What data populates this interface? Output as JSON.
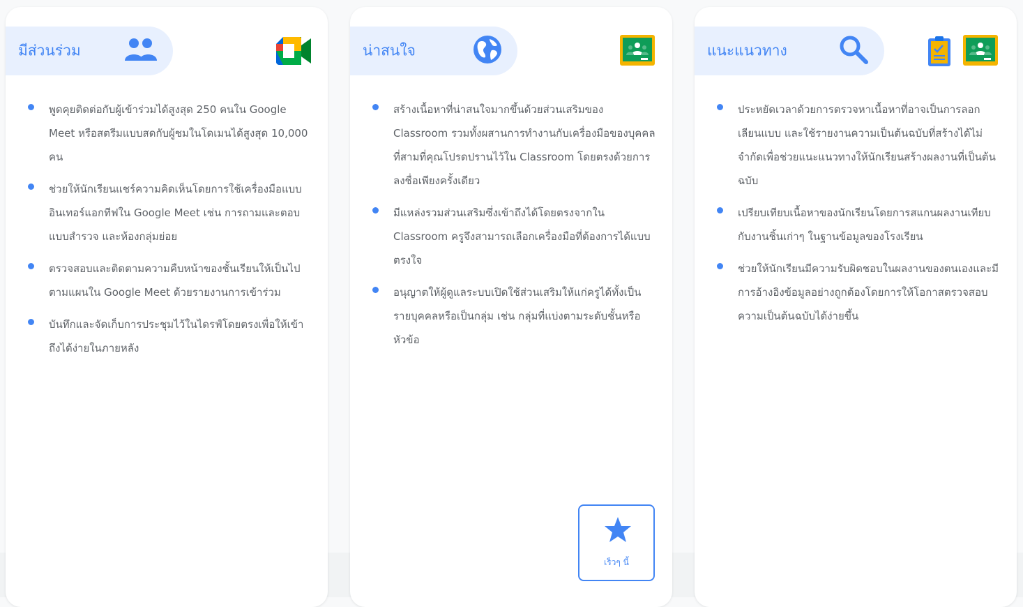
{
  "columns": [
    {
      "title": "มีส่วนร่วม",
      "header_icon": "people-icon",
      "product_icons": [
        "google-meet-icon"
      ],
      "items": [
        "พูดคุยติดต่อกับผู้เข้าร่วมได้สูงสุด 250 คนใน Google Meet หรือสตรีมแบบสดกับผู้ชมในโดเมนได้สูงสุด 10,000 คน",
        "ช่วยให้นักเรียนแชร์ความคิดเห็นโดยการใช้เครื่องมือแบบอินเทอร์แอกทีฟใน Google Meet เช่น การถามและตอบ แบบสำรวจ และห้องกลุ่มย่อย",
        "ตรวจสอบและติดตามความคืบหน้าของชั้นเรียนให้เป็นไปตามแผนใน Google Meet ด้วยรายงานการเข้าร่วม",
        "บันทึกและจัดเก็บการประชุมไว้ในไดรฟ์โดยตรงเพื่อให้เข้าถึงได้ง่ายในภายหลัง"
      ]
    },
    {
      "title": "น่าสนใจ",
      "header_icon": "globe-icon",
      "product_icons": [
        "google-classroom-icon"
      ],
      "items": [
        "สร้างเนื้อหาที่น่าสนใจมากขึ้นด้วยส่วนเสริมของ Classroom รวมทั้งผสานการทำงานกับเครื่องมือของบุคคลที่สามที่คุณโปรดปรานไว้ใน Classroom โดยตรงด้วยการลงชื่อเพียงครั้งเดียว",
        "มีแหล่งรวมส่วนเสริมซึ่งเข้าถึงได้โดยตรงจากใน Classroom ครูจึงสามารถเลือกเครื่องมือที่ต้องการได้แบบตรงใจ",
        "อนุญาตให้ผู้ดูแลระบบเปิดใช้ส่วนเสริมให้แก่ครูได้ทั้งเป็นรายบุคคลหรือเป็นกลุ่ม เช่น กลุ่มที่แบ่งตามระดับชั้นหรือหัวข้อ"
      ],
      "badge": {
        "label": "เร็วๆ นี้",
        "icon": "star-icon"
      }
    },
    {
      "title": "แนะแนวทาง",
      "header_icon": "search-icon",
      "product_icons": [
        "assignments-icon",
        "google-classroom-icon"
      ],
      "items": [
        "ประหยัดเวลาด้วยการตรวจหาเนื้อหาที่อาจเป็นการลอกเลียนแบบ และใช้รายงานความเป็นต้นฉบับที่สร้างได้ไม่จำกัดเพื่อช่วยแนะแนวทางให้นักเรียนสร้างผลงานที่เป็นต้นฉบับ",
        "เปรียบเทียบเนื้อหาของนักเรียนโดยการสแกนผลงานเทียบกับงานชิ้นเก่าๆ ในฐานข้อมูลของโรงเรียน",
        "ช่วยให้นักเรียนมีความรับผิดชอบในผลงานของตนเองและมีการอ้างอิงข้อมูลอย่างถูกต้องโดยการให้โอกาสตรวจสอบความเป็นต้นฉบับได้ง่ายขึ้น"
      ]
    }
  ],
  "colors": {
    "accent": "#4285f4",
    "pill_bg": "#e8f0fe",
    "text": "#5f6368",
    "classroom_green": "#0f9d58",
    "classroom_yellow": "#f4b400"
  }
}
